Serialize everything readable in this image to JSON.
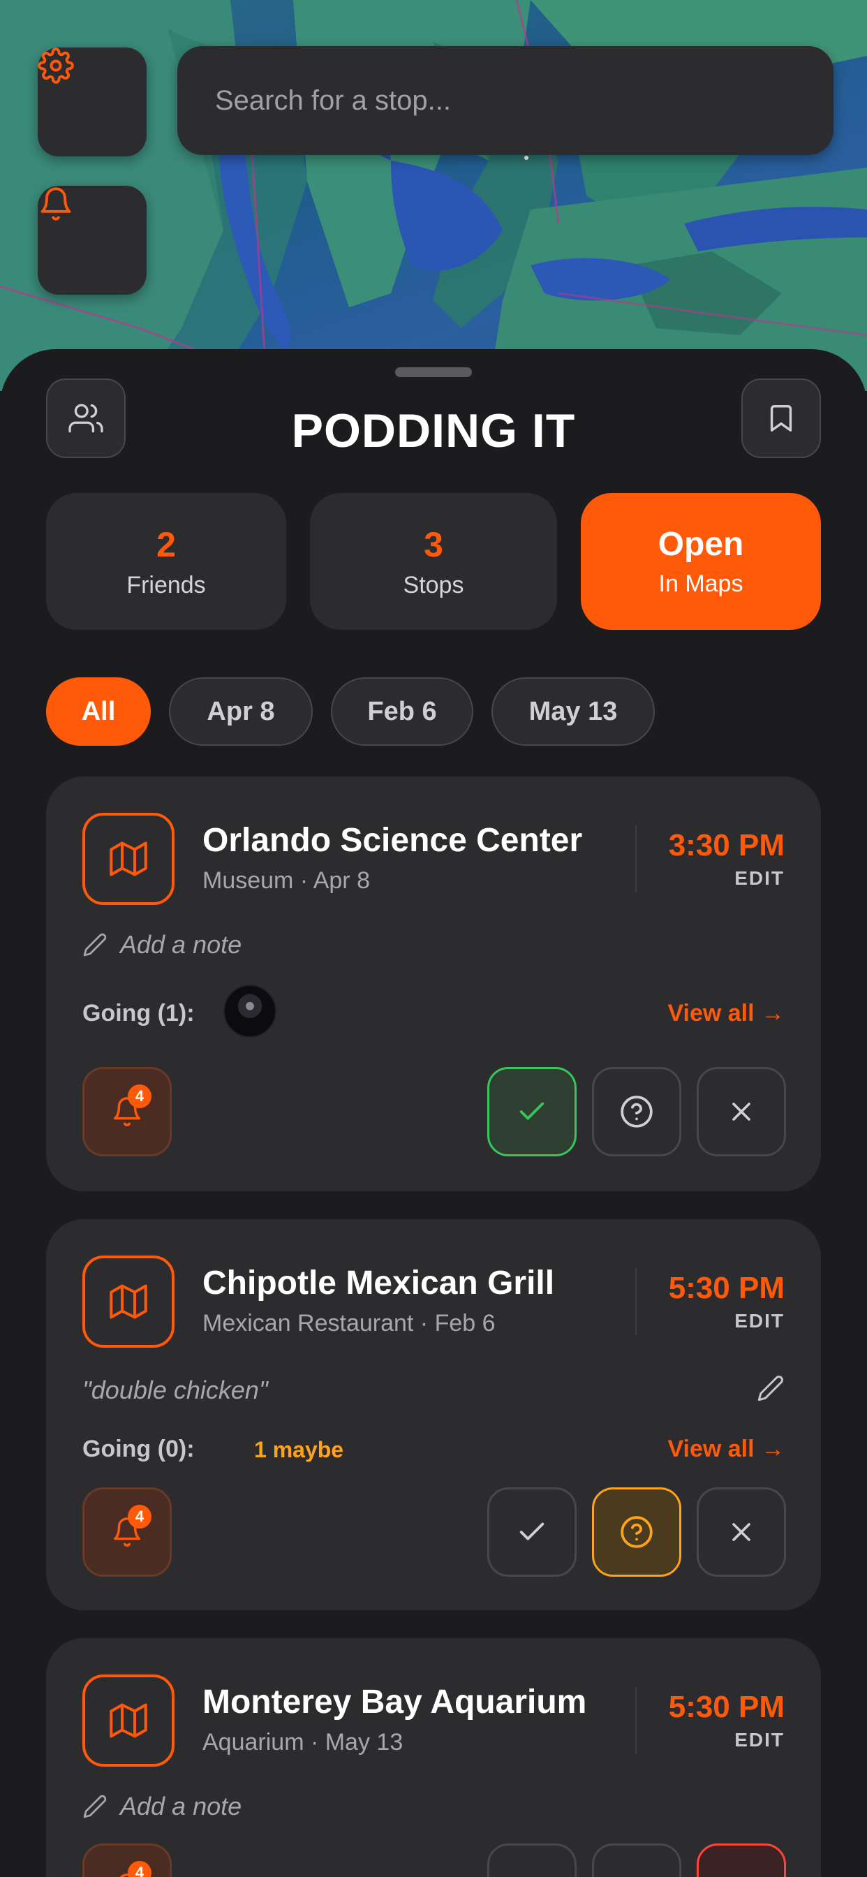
{
  "search": {
    "placeholder": "Search for a stop..."
  },
  "map_buttons": [
    {
      "icon": "gear-icon"
    },
    {
      "icon": "bell-icon"
    }
  ],
  "sheet": {
    "title": "PODDING IT",
    "left_icon": "users-icon",
    "right_icon": "bookmark-icon"
  },
  "stats": {
    "friends": {
      "value": "2",
      "label": "Friends"
    },
    "stops": {
      "value": "3",
      "label": "Stops"
    },
    "open": {
      "value": "Open",
      "label": "In Maps"
    }
  },
  "filters": [
    {
      "label": "All",
      "active": true
    },
    {
      "label": "Apr 8",
      "active": false
    },
    {
      "label": "Feb 6",
      "active": false
    },
    {
      "label": "May 13",
      "active": false
    }
  ],
  "cards": [
    {
      "title": "Orlando Science Center",
      "subtitle": "Museum · Apr 8",
      "time": "3:30 PM",
      "edit": "EDIT",
      "note": "Add a note",
      "going": "Going (1):",
      "view_all": "View all →",
      "bell_count": "4",
      "rsvp": "yes"
    },
    {
      "title": "Chipotle Mexican Grill",
      "subtitle": "Mexican Restaurant · Feb 6",
      "time": "5:30 PM",
      "edit": "EDIT",
      "note": "\"double chicken\"",
      "going": "Going (0):",
      "maybe": "1 maybe",
      "view_all": "View all →",
      "bell_count": "4",
      "rsvp": "maybe"
    },
    {
      "title": "Monterey Bay Aquarium",
      "subtitle": "Aquarium · May 13",
      "time": "5:30 PM",
      "edit": "EDIT",
      "note": "Add a note",
      "bell_count": "4",
      "rsvp": "no"
    }
  ],
  "colors": {
    "accent": "#ff5a0a",
    "yes": "#34c759",
    "maybe": "#ffa31a",
    "no": "#ff453a"
  }
}
